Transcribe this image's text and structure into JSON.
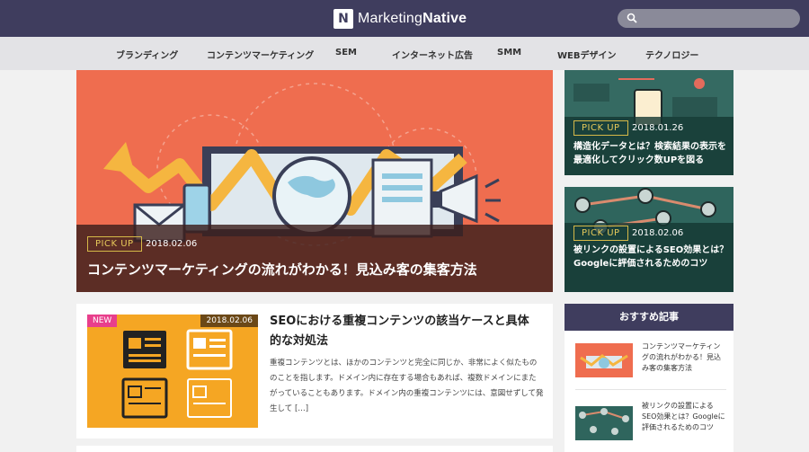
{
  "header": {
    "logo_mark": "N",
    "logo_text_light": "Marketing",
    "logo_text_bold": "Native",
    "search_icon": "search-icon",
    "search_placeholder": ""
  },
  "nav": {
    "items": [
      "ブランディング",
      "コンテンツマーケティング",
      "SEM",
      "インターネット広告",
      "SMM",
      "WEBデザイン",
      "テクノロジー"
    ]
  },
  "hero": {
    "badge": "PICK UP",
    "date": "2018.02.06",
    "title": "コンテンツマーケティングの流れがわかる！見込み客の集客方法"
  },
  "side_cards": [
    {
      "badge": "PICK UP",
      "date": "2018.01.26",
      "title": "構造化データとは？検索結果の表示を最適化してクリック数UPを図る"
    },
    {
      "badge": "PICK UP",
      "date": "2018.02.06",
      "title": "被リンクの設置によるSEO効果とは？Googleに評価されるためのコツ"
    }
  ],
  "recommended": {
    "heading": "おすすめ記事",
    "items": [
      {
        "text": "コンテンツマーケティングの流れがわかる！見込み客の集客方法"
      },
      {
        "text": "被リンクの設置によるSEO効果とは？Googleに評価されるためのコツ"
      }
    ]
  },
  "article": {
    "badge": "NEW",
    "date": "2018.02.06",
    "title": "SEOにおける重複コンテンツの該当ケースと具体的な対処法",
    "excerpt": "重複コンテンツとは、ほかのコンテンツと完全に同じか、非常によく似たもののことを指します。ドメイン内に存在する場合もあれば、複数ドメインにまたがっていることもあります。ドメイン内の重複コンテンツには、意図せずして発生して […]"
  },
  "colors": {
    "header_bg": "#3f3d5e",
    "nav_bg": "#e3e3e6",
    "hero_bg": "#ef6d4f",
    "pickup_gold": "#e6c95a",
    "new_badge": "#e83f8c",
    "thumb_orange": "#f5a623"
  }
}
